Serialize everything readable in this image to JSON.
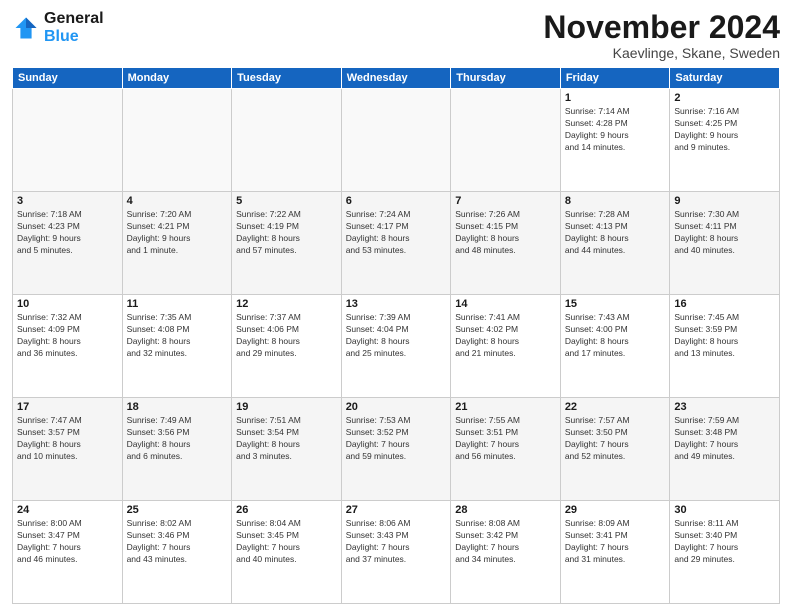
{
  "logo": {
    "line1": "General",
    "line2": "Blue"
  },
  "title": "November 2024",
  "location": "Kaevlinge, Skane, Sweden",
  "days": [
    "Sunday",
    "Monday",
    "Tuesday",
    "Wednesday",
    "Thursday",
    "Friday",
    "Saturday"
  ],
  "weeks": [
    [
      {
        "day": "",
        "detail": ""
      },
      {
        "day": "",
        "detail": ""
      },
      {
        "day": "",
        "detail": ""
      },
      {
        "day": "",
        "detail": ""
      },
      {
        "day": "",
        "detail": ""
      },
      {
        "day": "1",
        "detail": "Sunrise: 7:14 AM\nSunset: 4:28 PM\nDaylight: 9 hours\nand 14 minutes."
      },
      {
        "day": "2",
        "detail": "Sunrise: 7:16 AM\nSunset: 4:25 PM\nDaylight: 9 hours\nand 9 minutes."
      }
    ],
    [
      {
        "day": "3",
        "detail": "Sunrise: 7:18 AM\nSunset: 4:23 PM\nDaylight: 9 hours\nand 5 minutes."
      },
      {
        "day": "4",
        "detail": "Sunrise: 7:20 AM\nSunset: 4:21 PM\nDaylight: 9 hours\nand 1 minute."
      },
      {
        "day": "5",
        "detail": "Sunrise: 7:22 AM\nSunset: 4:19 PM\nDaylight: 8 hours\nand 57 minutes."
      },
      {
        "day": "6",
        "detail": "Sunrise: 7:24 AM\nSunset: 4:17 PM\nDaylight: 8 hours\nand 53 minutes."
      },
      {
        "day": "7",
        "detail": "Sunrise: 7:26 AM\nSunset: 4:15 PM\nDaylight: 8 hours\nand 48 minutes."
      },
      {
        "day": "8",
        "detail": "Sunrise: 7:28 AM\nSunset: 4:13 PM\nDaylight: 8 hours\nand 44 minutes."
      },
      {
        "day": "9",
        "detail": "Sunrise: 7:30 AM\nSunset: 4:11 PM\nDaylight: 8 hours\nand 40 minutes."
      }
    ],
    [
      {
        "day": "10",
        "detail": "Sunrise: 7:32 AM\nSunset: 4:09 PM\nDaylight: 8 hours\nand 36 minutes."
      },
      {
        "day": "11",
        "detail": "Sunrise: 7:35 AM\nSunset: 4:08 PM\nDaylight: 8 hours\nand 32 minutes."
      },
      {
        "day": "12",
        "detail": "Sunrise: 7:37 AM\nSunset: 4:06 PM\nDaylight: 8 hours\nand 29 minutes."
      },
      {
        "day": "13",
        "detail": "Sunrise: 7:39 AM\nSunset: 4:04 PM\nDaylight: 8 hours\nand 25 minutes."
      },
      {
        "day": "14",
        "detail": "Sunrise: 7:41 AM\nSunset: 4:02 PM\nDaylight: 8 hours\nand 21 minutes."
      },
      {
        "day": "15",
        "detail": "Sunrise: 7:43 AM\nSunset: 4:00 PM\nDaylight: 8 hours\nand 17 minutes."
      },
      {
        "day": "16",
        "detail": "Sunrise: 7:45 AM\nSunset: 3:59 PM\nDaylight: 8 hours\nand 13 minutes."
      }
    ],
    [
      {
        "day": "17",
        "detail": "Sunrise: 7:47 AM\nSunset: 3:57 PM\nDaylight: 8 hours\nand 10 minutes."
      },
      {
        "day": "18",
        "detail": "Sunrise: 7:49 AM\nSunset: 3:56 PM\nDaylight: 8 hours\nand 6 minutes."
      },
      {
        "day": "19",
        "detail": "Sunrise: 7:51 AM\nSunset: 3:54 PM\nDaylight: 8 hours\nand 3 minutes."
      },
      {
        "day": "20",
        "detail": "Sunrise: 7:53 AM\nSunset: 3:52 PM\nDaylight: 7 hours\nand 59 minutes."
      },
      {
        "day": "21",
        "detail": "Sunrise: 7:55 AM\nSunset: 3:51 PM\nDaylight: 7 hours\nand 56 minutes."
      },
      {
        "day": "22",
        "detail": "Sunrise: 7:57 AM\nSunset: 3:50 PM\nDaylight: 7 hours\nand 52 minutes."
      },
      {
        "day": "23",
        "detail": "Sunrise: 7:59 AM\nSunset: 3:48 PM\nDaylight: 7 hours\nand 49 minutes."
      }
    ],
    [
      {
        "day": "24",
        "detail": "Sunrise: 8:00 AM\nSunset: 3:47 PM\nDaylight: 7 hours\nand 46 minutes."
      },
      {
        "day": "25",
        "detail": "Sunrise: 8:02 AM\nSunset: 3:46 PM\nDaylight: 7 hours\nand 43 minutes."
      },
      {
        "day": "26",
        "detail": "Sunrise: 8:04 AM\nSunset: 3:45 PM\nDaylight: 7 hours\nand 40 minutes."
      },
      {
        "day": "27",
        "detail": "Sunrise: 8:06 AM\nSunset: 3:43 PM\nDaylight: 7 hours\nand 37 minutes."
      },
      {
        "day": "28",
        "detail": "Sunrise: 8:08 AM\nSunset: 3:42 PM\nDaylight: 7 hours\nand 34 minutes."
      },
      {
        "day": "29",
        "detail": "Sunrise: 8:09 AM\nSunset: 3:41 PM\nDaylight: 7 hours\nand 31 minutes."
      },
      {
        "day": "30",
        "detail": "Sunrise: 8:11 AM\nSunset: 3:40 PM\nDaylight: 7 hours\nand 29 minutes."
      }
    ]
  ]
}
